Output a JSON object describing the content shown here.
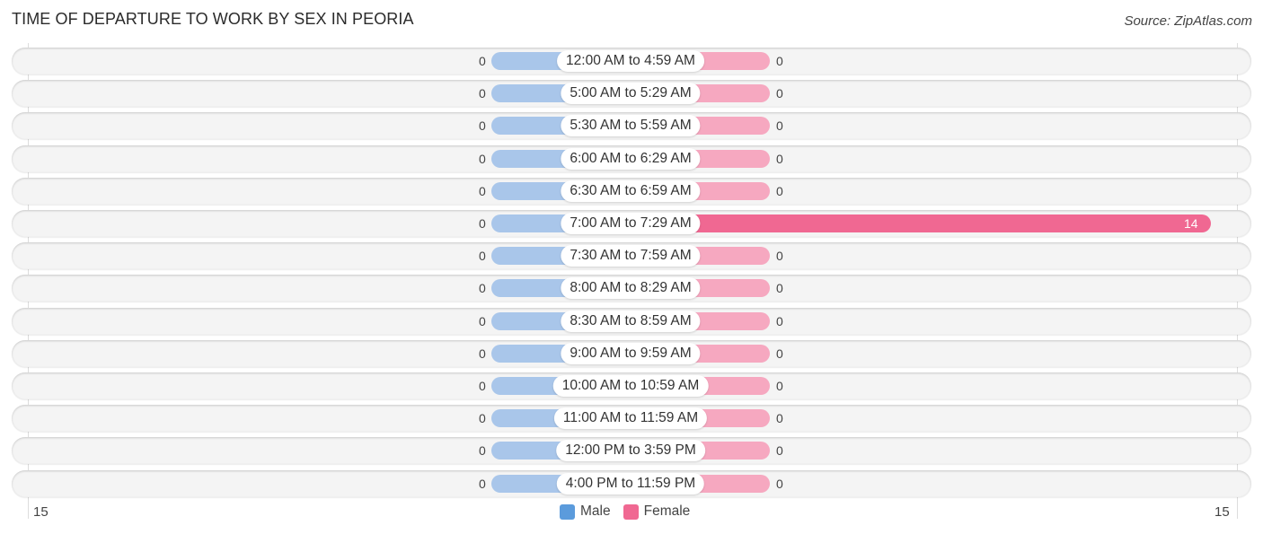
{
  "title": "TIME OF DEPARTURE TO WORK BY SEX IN PEORIA",
  "source": "Source: ZipAtlas.com",
  "colors": {
    "male": "#5b9bdc",
    "female": "#f06892",
    "male_light": "#a9c6ea",
    "female_light": "#f6a8c0"
  },
  "chart_data": {
    "type": "bar",
    "orientation": "horizontal-diverging",
    "title": "TIME OF DEPARTURE TO WORK BY SEX IN PEORIA",
    "categories": [
      "12:00 AM to 4:59 AM",
      "5:00 AM to 5:29 AM",
      "5:30 AM to 5:59 AM",
      "6:00 AM to 6:29 AM",
      "6:30 AM to 6:59 AM",
      "7:00 AM to 7:29 AM",
      "7:30 AM to 7:59 AM",
      "8:00 AM to 8:29 AM",
      "8:30 AM to 8:59 AM",
      "9:00 AM to 9:59 AM",
      "10:00 AM to 10:59 AM",
      "11:00 AM to 11:59 AM",
      "12:00 PM to 3:59 PM",
      "4:00 PM to 11:59 PM"
    ],
    "series": [
      {
        "name": "Male",
        "values": [
          0,
          0,
          0,
          0,
          0,
          0,
          0,
          0,
          0,
          0,
          0,
          0,
          0,
          0
        ]
      },
      {
        "name": "Female",
        "values": [
          0,
          0,
          0,
          0,
          0,
          14,
          0,
          0,
          0,
          0,
          0,
          0,
          0,
          0
        ]
      }
    ],
    "xlim": [
      -15,
      15
    ],
    "axis_tick_labels": {
      "left": "15",
      "right": "15"
    },
    "legend": {
      "position": "bottom-center",
      "entries": [
        "Male",
        "Female"
      ]
    }
  }
}
